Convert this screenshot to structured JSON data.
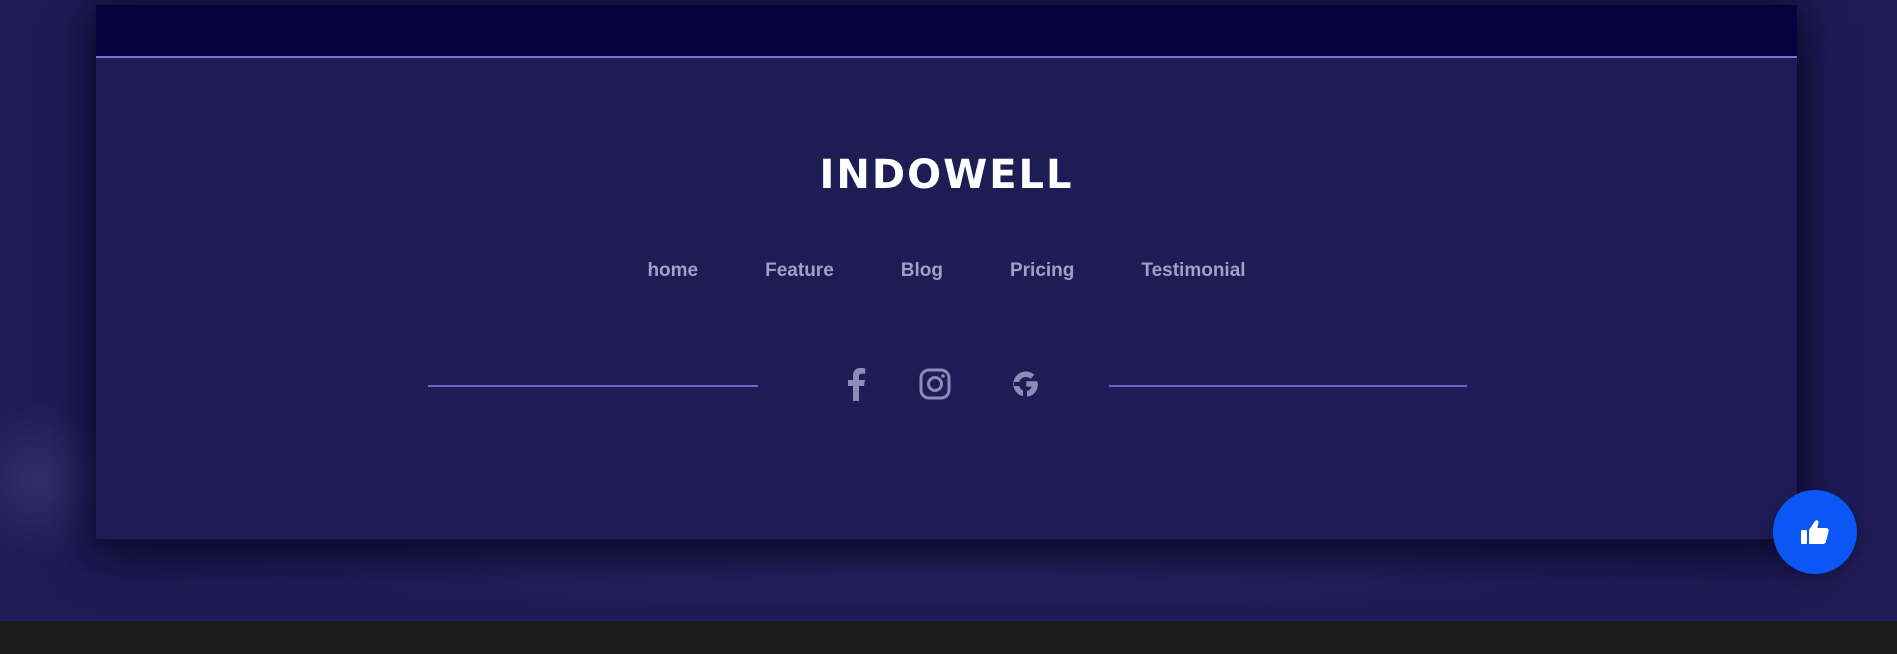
{
  "footer": {
    "brand": "INDOWELL",
    "nav": [
      {
        "label": "home"
      },
      {
        "label": "Feature"
      },
      {
        "label": "Blog"
      },
      {
        "label": "Pricing"
      },
      {
        "label": "Testimonial"
      }
    ],
    "social": [
      {
        "icon": "facebook-icon"
      },
      {
        "icon": "instagram-icon"
      },
      {
        "icon": "google-icon"
      }
    ]
  },
  "fab": {
    "icon": "thumbs-up-icon"
  },
  "colors": {
    "page_background": "#1f1b55",
    "top_band": "#04033f",
    "accent_line": "#7b6ed9",
    "nav_text": "#a29fc6",
    "brand_text": "#ffffff",
    "fab": "#0b57f5",
    "bottom_bar": "#1b1b1b"
  }
}
